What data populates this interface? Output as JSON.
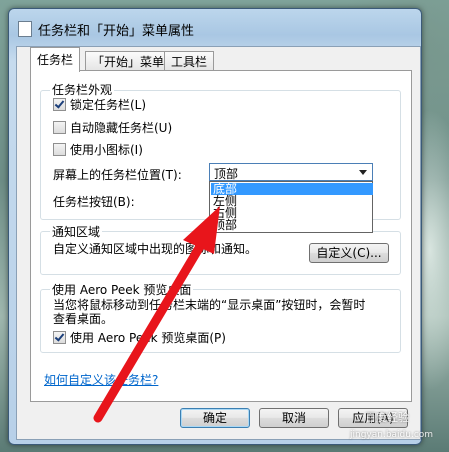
{
  "window": {
    "title": "任务栏和「开始」菜单属性"
  },
  "tabs": [
    {
      "label": "任务栏"
    },
    {
      "label": "「开始」菜单"
    },
    {
      "label": "工具栏"
    }
  ],
  "appearance": {
    "title": "任务栏外观",
    "lock": {
      "label": "锁定任务栏(L)",
      "checked": true
    },
    "autohide": {
      "label": "自动隐藏任务栏(U)",
      "checked": false
    },
    "small_icons": {
      "label": "使用小图标(I)",
      "checked": false
    },
    "location_label": "屏幕上的任务栏位置(T):",
    "location_value": "顶部",
    "location_options": [
      "底部",
      "左侧",
      "右侧",
      "顶部"
    ],
    "buttons_label": "任务栏按钮(B):"
  },
  "notification": {
    "title": "通知区域",
    "desc": "自定义通知区域中出现的图标和通知。",
    "customize_button": "自定义(C)..."
  },
  "aero_peek": {
    "title": "使用 Aero Peek 预览桌面",
    "desc_line1": "当您将鼠标移动到任务栏末端的“显示桌面”按钮时，会暂时",
    "desc_line2": "查看桌面。",
    "checkbox": {
      "label": "使用 Aero Peek 预览桌面(P)",
      "checked": true
    }
  },
  "link": {
    "label": "如何自定义该任务栏?"
  },
  "buttons": {
    "ok": "确定",
    "cancel": "取消",
    "apply": "应用(A)"
  },
  "overlay": {
    "watermark": "百度经验",
    "watermark_url": "jingyan.baidu.com",
    "arrow_color": "#e8151b"
  }
}
